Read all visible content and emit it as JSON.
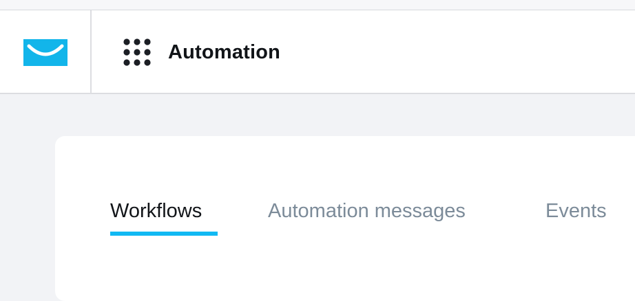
{
  "header": {
    "title": "Automation",
    "logo_icon": "getresponse-envelope-logo",
    "apps_icon": "app-grid-icon"
  },
  "tabs": [
    {
      "label": "Workflows",
      "active": true
    },
    {
      "label": "Automation messages",
      "active": false
    },
    {
      "label": "Events",
      "active": false
    }
  ],
  "colors": {
    "accent": "#11b9f3",
    "logo": "#12b5ea",
    "active_tab_text": "#111418",
    "inactive_tab_text": "#7c8b99",
    "page_background": "#f2f3f6"
  }
}
